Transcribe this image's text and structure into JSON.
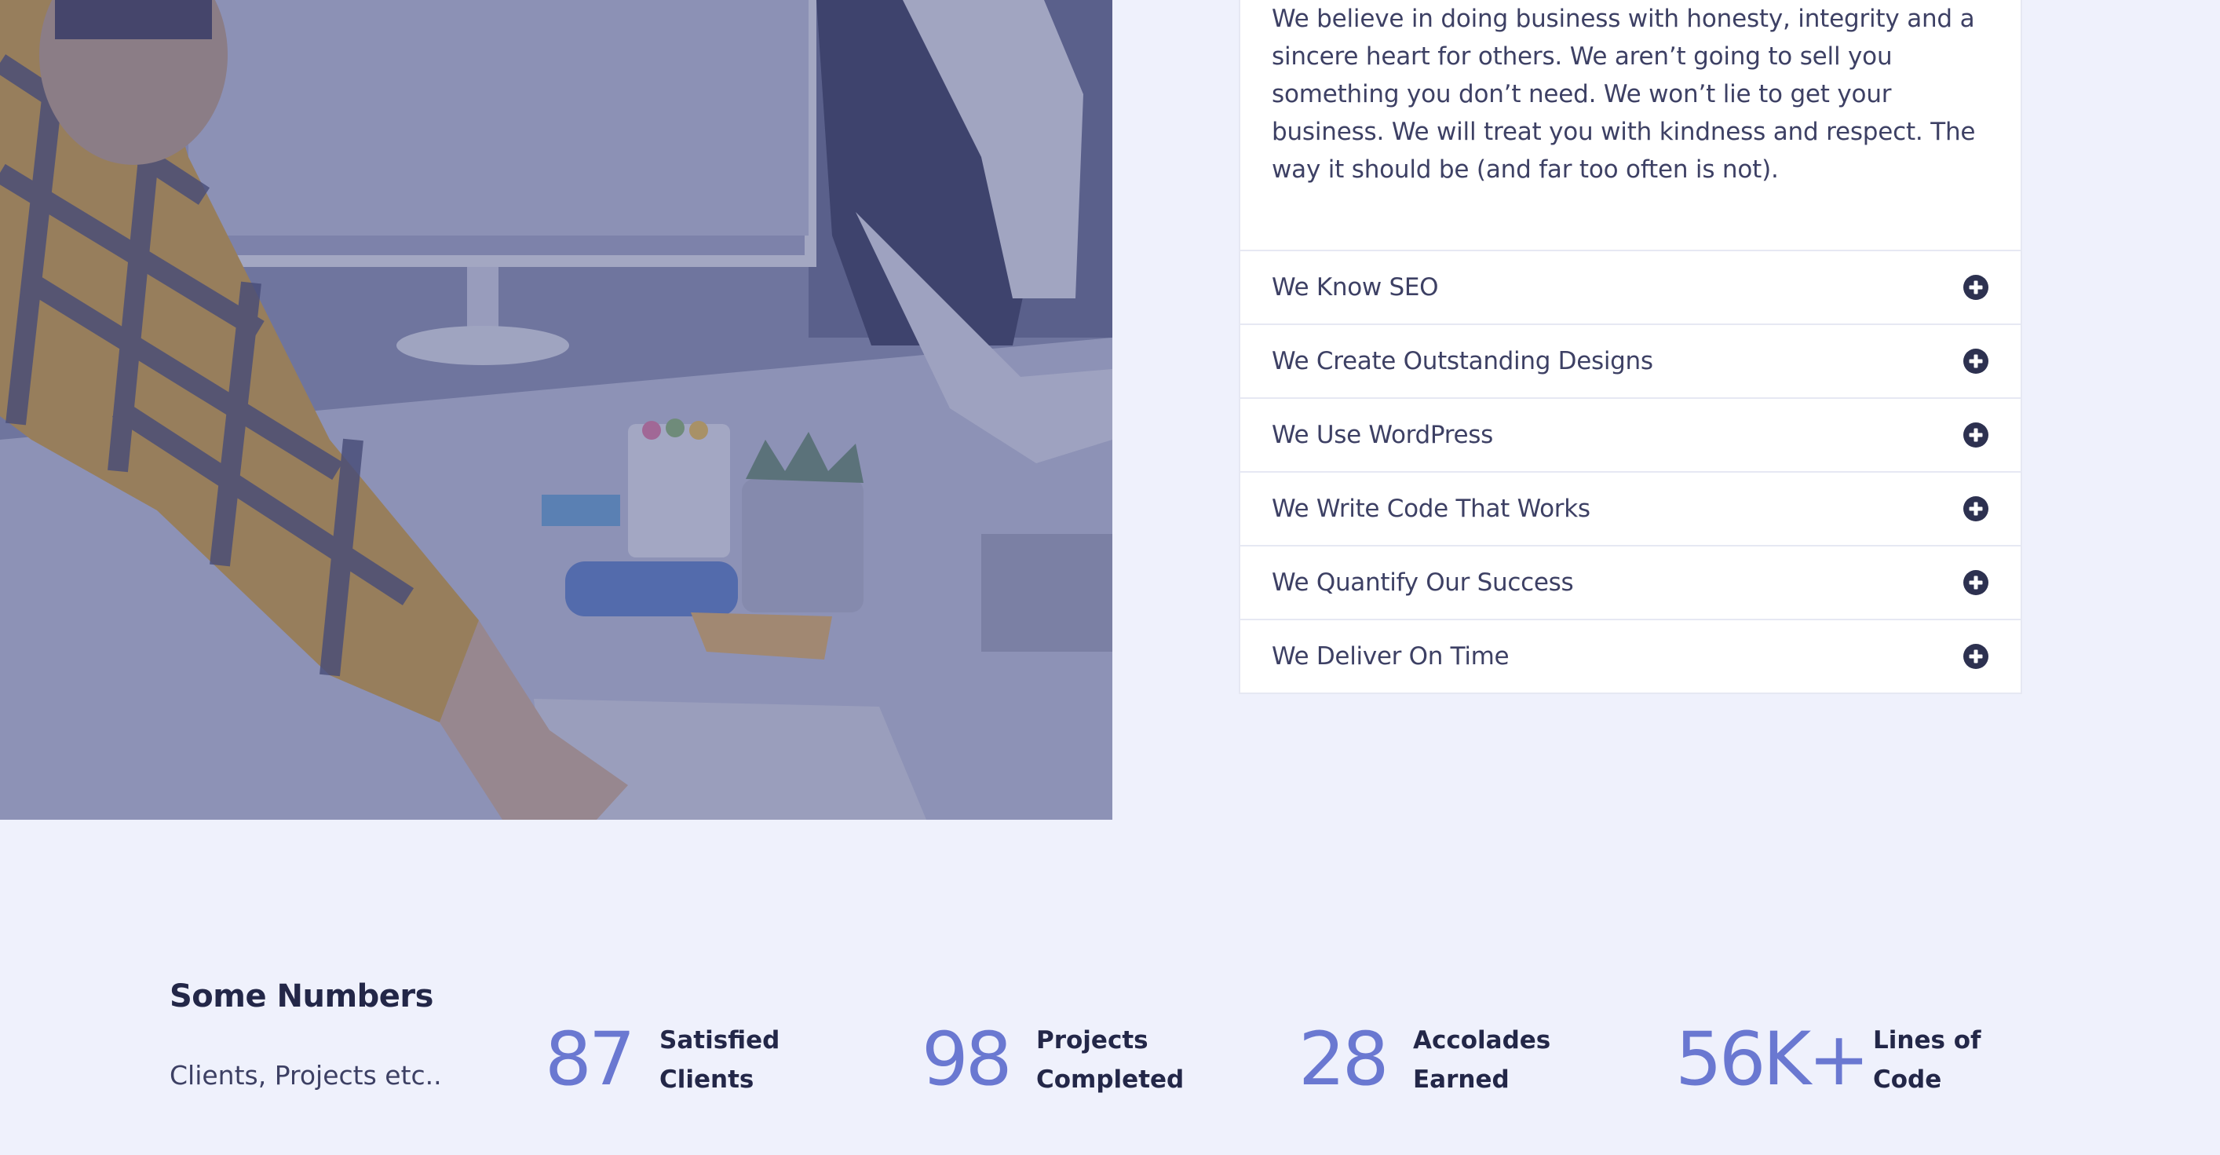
{
  "about": {
    "paragraph": "We believe in doing business with honesty, integrity and a sincere heart for others. We aren’t going to sell you something you don’t need. We won’t lie to get your business. We will treat you with kindness and respect. The way it should be (and far too often is not)."
  },
  "accordion": {
    "icon": "plus-circle-icon",
    "items": [
      {
        "label": "We Know SEO"
      },
      {
        "label": "We Create Outstanding Designs"
      },
      {
        "label": "We Use WordPress"
      },
      {
        "label": "We Write Code That Works"
      },
      {
        "label": "We Quantify Our Success"
      },
      {
        "label": "We Deliver On Time"
      }
    ]
  },
  "numbers": {
    "title": "Some Numbers",
    "subtitle": "Clients, Projects etc..",
    "stats": [
      {
        "value": "87",
        "label_line1": "Satisfied",
        "label_line2": "Clients"
      },
      {
        "value": "98",
        "label_line1": "Projects",
        "label_line2": "Completed"
      },
      {
        "value": "28",
        "label_line1": "Accolades",
        "label_line2": "Earned"
      },
      {
        "value": "56K+",
        "label_line1": "Lines of",
        "label_line2": "Code"
      }
    ]
  },
  "colors": {
    "page_background": "#eff1fc",
    "accent": "#6a78d1",
    "heading": "#232748",
    "body_text": "#3d4064",
    "icon": "#2d3150"
  }
}
